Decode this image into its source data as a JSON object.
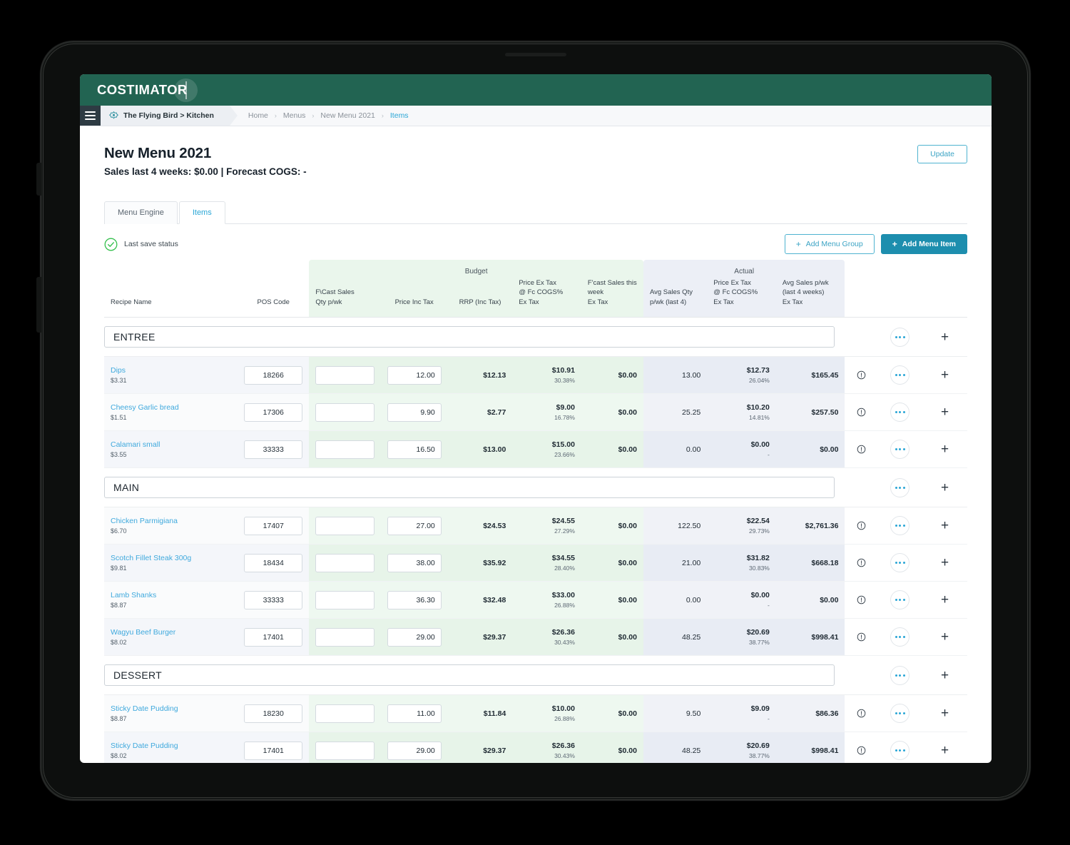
{
  "app": {
    "logo_text": "COSTIMATOR",
    "brand_green": "#226452",
    "accent_blue": "#2aa6d6"
  },
  "breadcrumb": {
    "site": "The Flying Bird > Kitchen",
    "path": [
      "Home",
      "Menus",
      "New Menu 2021",
      "Items"
    ],
    "separator": "›",
    "active_index": 3
  },
  "header": {
    "title": "New Menu 2021",
    "subtitle": "Sales last 4 weeks: $0.00 | Forecast COGS: -",
    "update_label": "Update"
  },
  "tabs": [
    {
      "label": "Menu Engine",
      "active": false
    },
    {
      "label": "Items",
      "active": true
    }
  ],
  "status": {
    "save_label": "Last save status"
  },
  "actions": {
    "add_group_label": "Add Menu Group",
    "add_item_label": "Add Menu Item",
    "plus_glyph": "+"
  },
  "table": {
    "bands": [
      {
        "label": "Budget",
        "colspan": 5
      },
      {
        "label": "Actual",
        "colspan": 3
      }
    ],
    "columns": [
      "Recipe Name",
      "POS Code",
      "F\\Cast Sales\nQty p/wk",
      "Price Inc Tax",
      "RRP (Inc Tax)",
      "Price Ex Tax\n@ Fc COGS%\nEx Tax",
      "F'cast Sales this\nweek\nEx Tax",
      "Avg Sales Qty\np/wk (last 4)",
      "Price Ex Tax\n@ Fc COGS%\nEx Tax",
      "Avg Sales p/wk\n(last 4 weeks)\nEx Tax"
    ],
    "column_labels": {
      "recipe_name": "Recipe Name",
      "pos_code": "POS Code",
      "fcast_qty_l1": "F\\Cast Sales",
      "fcast_qty_l2": "Qty p/wk",
      "price_inc_tax": "Price Inc Tax",
      "rrp_inc_tax": "RRP (Inc Tax)",
      "b_price_ex_l1": "Price Ex Tax",
      "b_price_ex_l2": "@ Fc COGS%",
      "b_price_ex_l3": "Ex Tax",
      "b_fcast_l1": "F'cast Sales this",
      "b_fcast_l2": "week",
      "b_fcast_l3": "Ex Tax",
      "a_qty_l1": "Avg Sales Qty",
      "a_qty_l2": "p/wk (last 4)",
      "a_price_ex_l1": "Price Ex Tax",
      "a_price_ex_l2": "@ Fc COGS%",
      "a_price_ex_l3": "Ex Tax",
      "a_avg_l1": "Avg Sales p/wk",
      "a_avg_l2": "(last 4 weeks)",
      "a_avg_l3": "Ex Tax"
    },
    "groups": [
      {
        "name": "ENTREE",
        "items": [
          {
            "recipe_name": "Dips",
            "recipe_cost": "$3.31",
            "pos_code": "18266",
            "fcast_qty": "",
            "price_inc_tax": "12.00",
            "rrp_inc_tax": "$12.13",
            "b_price_ex_tax": "$10.91",
            "b_cogs_pct": "30.38%",
            "b_fcast_sales": "$0.00",
            "a_avg_qty": "13.00",
            "a_price_ex_tax": "$12.73",
            "a_cogs_pct": "26.04%",
            "a_avg_sales": "$165.45"
          },
          {
            "recipe_name": "Cheesy Garlic bread",
            "recipe_cost": "$1.51",
            "pos_code": "17306",
            "fcast_qty": "",
            "price_inc_tax": "9.90",
            "rrp_inc_tax": "$2.77",
            "b_price_ex_tax": "$9.00",
            "b_cogs_pct": "16.78%",
            "b_fcast_sales": "$0.00",
            "a_avg_qty": "25.25",
            "a_price_ex_tax": "$10.20",
            "a_cogs_pct": "14.81%",
            "a_avg_sales": "$257.50"
          },
          {
            "recipe_name": "Calamari small",
            "recipe_cost": "$3.55",
            "pos_code": "33333",
            "fcast_qty": "",
            "price_inc_tax": "16.50",
            "rrp_inc_tax": "$13.00",
            "b_price_ex_tax": "$15.00",
            "b_cogs_pct": "23.66%",
            "b_fcast_sales": "$0.00",
            "a_avg_qty": "0.00",
            "a_price_ex_tax": "$0.00",
            "a_cogs_pct": "-",
            "a_avg_sales": "$0.00"
          }
        ]
      },
      {
        "name": "MAIN",
        "items": [
          {
            "recipe_name": "Chicken Parmigiana",
            "recipe_cost": "$6.70",
            "pos_code": "17407",
            "fcast_qty": "",
            "price_inc_tax": "27.00",
            "rrp_inc_tax": "$24.53",
            "b_price_ex_tax": "$24.55",
            "b_cogs_pct": "27.29%",
            "b_fcast_sales": "$0.00",
            "a_avg_qty": "122.50",
            "a_price_ex_tax": "$22.54",
            "a_cogs_pct": "29.73%",
            "a_avg_sales": "$2,761.36"
          },
          {
            "recipe_name": "Scotch Fillet Steak 300g",
            "recipe_cost": "$9.81",
            "pos_code": "18434",
            "fcast_qty": "",
            "price_inc_tax": "38.00",
            "rrp_inc_tax": "$35.92",
            "b_price_ex_tax": "$34.55",
            "b_cogs_pct": "28.40%",
            "b_fcast_sales": "$0.00",
            "a_avg_qty": "21.00",
            "a_price_ex_tax": "$31.82",
            "a_cogs_pct": "30.83%",
            "a_avg_sales": "$668.18"
          },
          {
            "recipe_name": "Lamb Shanks",
            "recipe_cost": "$8.87",
            "pos_code": "33333",
            "fcast_qty": "",
            "price_inc_tax": "36.30",
            "rrp_inc_tax": "$32.48",
            "b_price_ex_tax": "$33.00",
            "b_cogs_pct": "26.88%",
            "b_fcast_sales": "$0.00",
            "a_avg_qty": "0.00",
            "a_price_ex_tax": "$0.00",
            "a_cogs_pct": "-",
            "a_avg_sales": "$0.00"
          },
          {
            "recipe_name": "Wagyu Beef Burger",
            "recipe_cost": "$8.02",
            "pos_code": "17401",
            "fcast_qty": "",
            "price_inc_tax": "29.00",
            "rrp_inc_tax": "$29.37",
            "b_price_ex_tax": "$26.36",
            "b_cogs_pct": "30.43%",
            "b_fcast_sales": "$0.00",
            "a_avg_qty": "48.25",
            "a_price_ex_tax": "$20.69",
            "a_cogs_pct": "38.77%",
            "a_avg_sales": "$998.41"
          }
        ]
      },
      {
        "name": "DESSERT",
        "items": [
          {
            "recipe_name": "Sticky Date Pudding",
            "recipe_cost": "$8.87",
            "pos_code": "18230",
            "fcast_qty": "",
            "price_inc_tax": "11.00",
            "rrp_inc_tax": "$11.84",
            "b_price_ex_tax": "$10.00",
            "b_cogs_pct": "26.88%",
            "b_fcast_sales": "$0.00",
            "a_avg_qty": "9.50",
            "a_price_ex_tax": "$9.09",
            "a_cogs_pct": "-",
            "a_avg_sales": "$86.36"
          },
          {
            "recipe_name": "Sticky Date Pudding",
            "recipe_cost": "$8.02",
            "pos_code": "17401",
            "fcast_qty": "",
            "price_inc_tax": "29.00",
            "rrp_inc_tax": "$29.37",
            "b_price_ex_tax": "$26.36",
            "b_cogs_pct": "30.43%",
            "b_fcast_sales": "$0.00",
            "a_avg_qty": "48.25",
            "a_price_ex_tax": "$20.69",
            "a_cogs_pct": "38.77%",
            "a_avg_sales": "$998.41"
          }
        ]
      }
    ]
  }
}
